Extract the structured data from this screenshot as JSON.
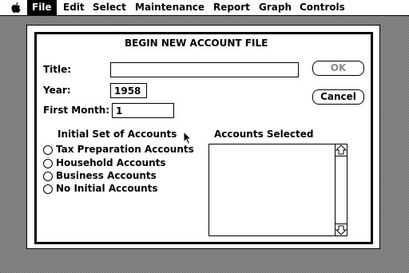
{
  "menubar": {
    "items": [
      {
        "label": "File",
        "active": true
      },
      {
        "label": "Edit"
      },
      {
        "label": "Select"
      },
      {
        "label": "Maintenance"
      },
      {
        "label": "Report"
      },
      {
        "label": "Graph"
      },
      {
        "label": "Controls"
      }
    ]
  },
  "dialog": {
    "title": "BEGIN NEW ACCOUNT FILE",
    "fields": {
      "title_label": "Title:",
      "title_value": "",
      "year_label": "Year:",
      "year_value": "1958",
      "first_month_label": "First Month:",
      "first_month_value": "1"
    },
    "buttons": {
      "ok": "OK",
      "ok_enabled": false,
      "cancel": "Cancel"
    },
    "initial_accounts": {
      "heading": "Initial Set of Accounts",
      "options": [
        "Tax Preparation Accounts",
        "Household Accounts",
        "Business Accounts",
        "No Initial Accounts"
      ],
      "selected": null
    },
    "accounts_selected": {
      "heading": "Accounts Selected",
      "items": []
    }
  },
  "icons": [
    "apple-icon",
    "scroll-up-arrow-icon",
    "scroll-down-arrow-icon",
    "arrow-cursor-icon"
  ]
}
